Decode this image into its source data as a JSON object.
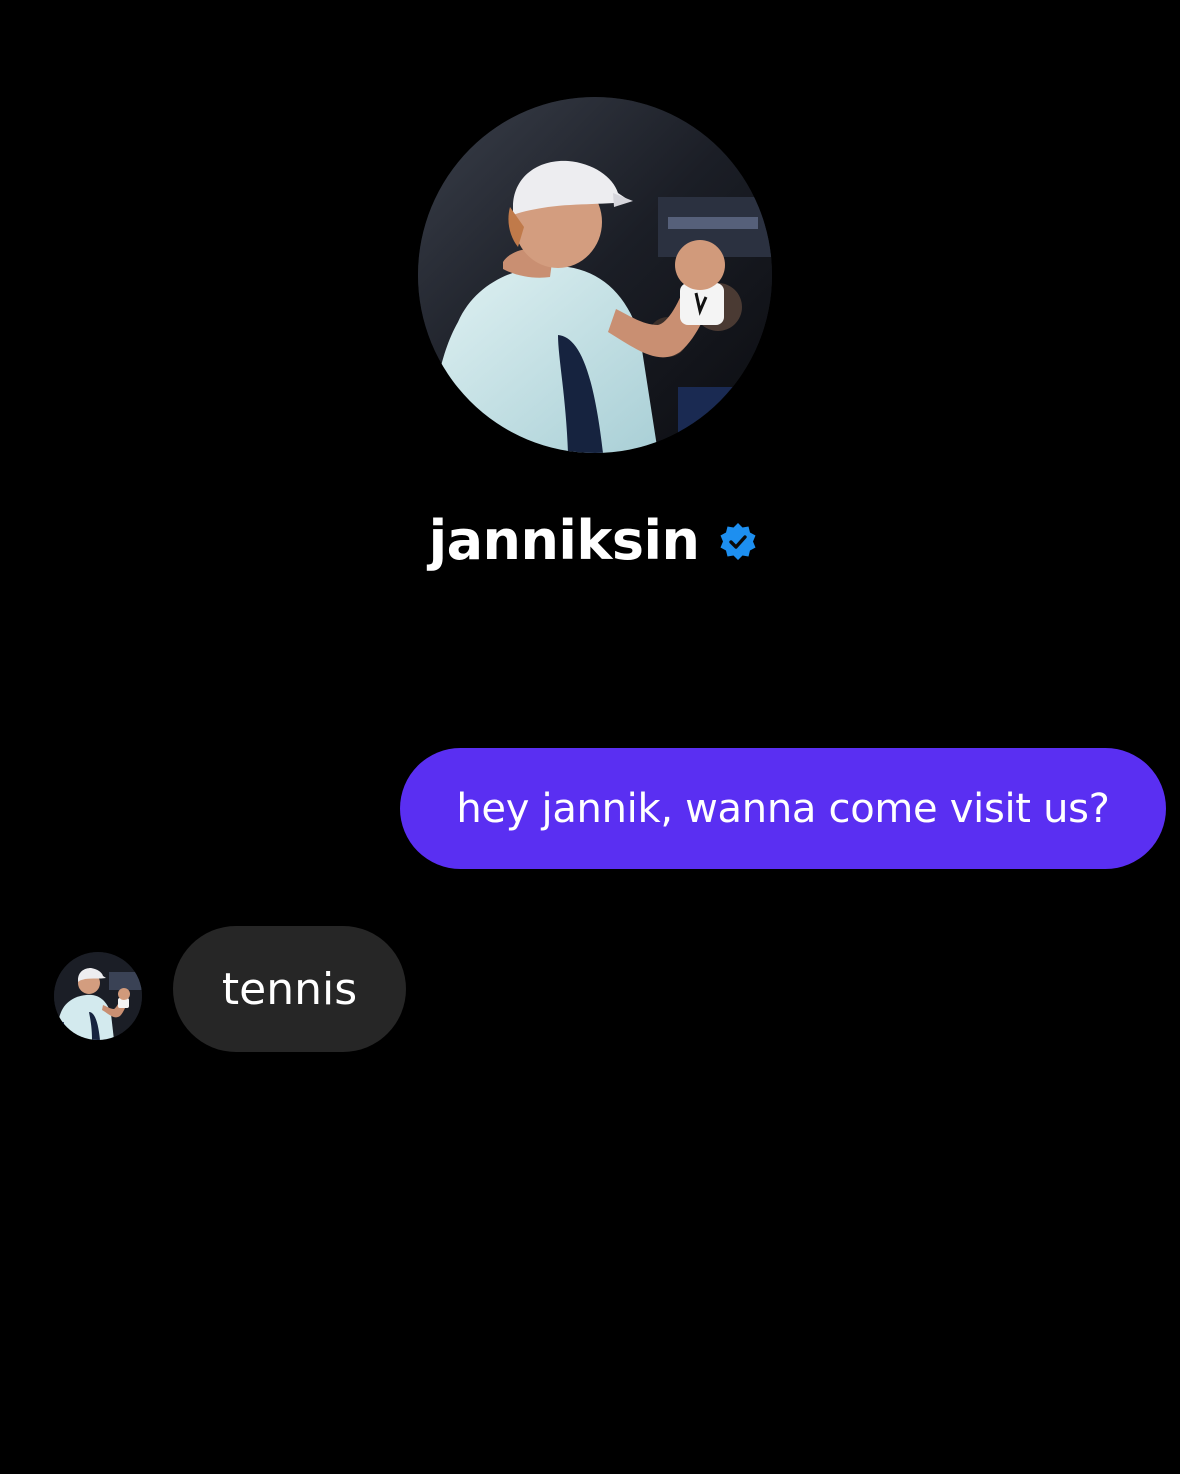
{
  "profile": {
    "username": "janniksin",
    "verified": true,
    "avatar_icon": "profile-photo-tennis-player",
    "verified_icon": "verified-badge-icon",
    "verified_color": "#1d8ff0"
  },
  "messages": [
    {
      "direction": "sent",
      "text": "hey jannik, wanna come visit us?",
      "bubble_color": "#5a2ff2"
    },
    {
      "direction": "received",
      "text": "tennis",
      "bubble_color": "#262626",
      "avatar_icon": "sender-avatar-icon"
    }
  ],
  "theme": {
    "background": "#000000",
    "text": "#ffffff"
  }
}
